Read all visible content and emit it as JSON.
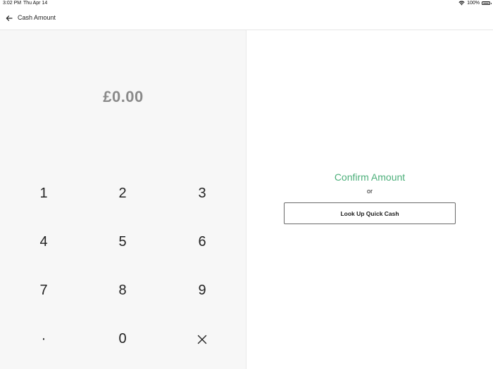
{
  "status_bar": {
    "time": "3:02 PM",
    "date": "Thu Apr 14",
    "battery": "100%",
    "wifi_icon": "wifi-icon",
    "battery_icon": "battery-icon"
  },
  "nav": {
    "title": "Cash Amount",
    "back_icon": "arrow-left-icon"
  },
  "amount": {
    "display": "£0.00"
  },
  "keypad": {
    "keys": [
      "1",
      "2",
      "3",
      "4",
      "5",
      "6",
      "7",
      "8",
      "9",
      "·",
      "0"
    ],
    "delete_icon": "delete-x-icon"
  },
  "actions": {
    "confirm_label": "Confirm Amount",
    "or_label": "or",
    "quick_cash_label": "Look Up Quick Cash"
  },
  "colors": {
    "accent_green": "#4caf7a",
    "amount_gray": "#8a8a8a",
    "left_pane_bg": "#f7f7f7"
  }
}
